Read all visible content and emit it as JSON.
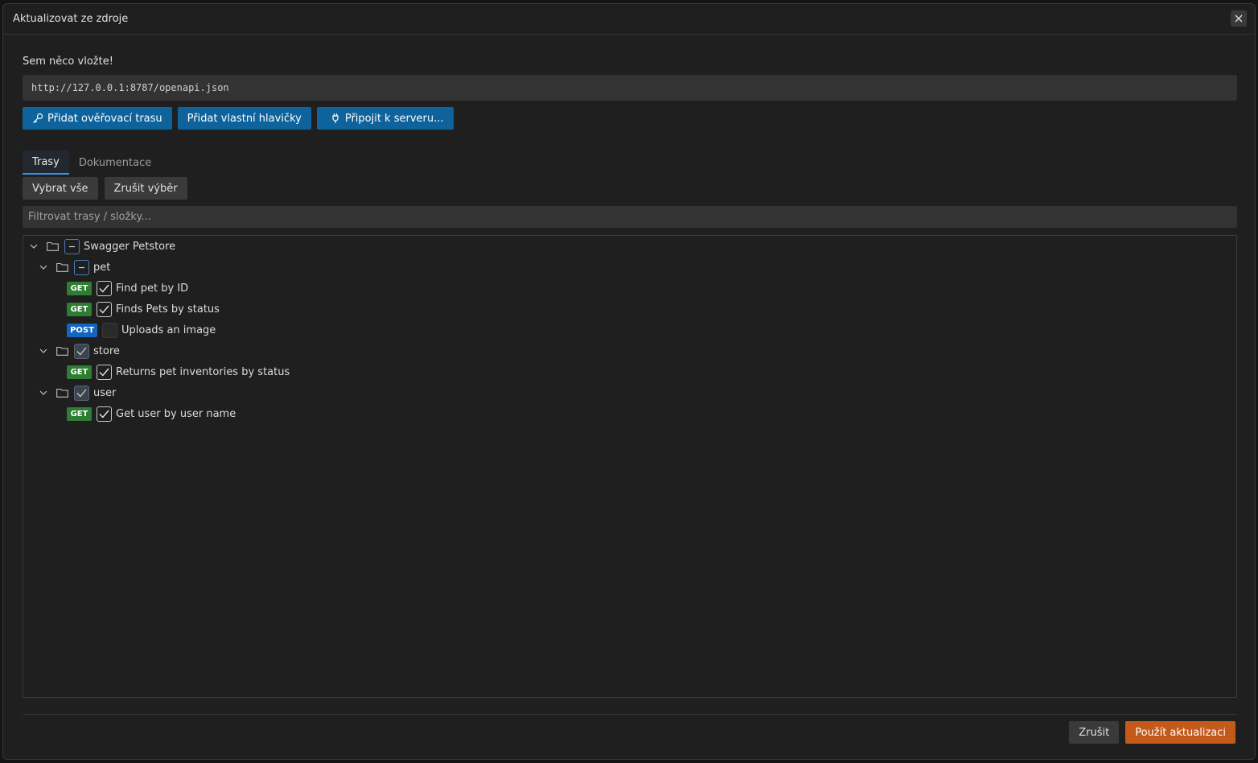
{
  "dialog": {
    "title": "Aktualizovat ze zdroje",
    "prompt": "Sem něco vložte!",
    "url_value": "http://127.0.0.1:8787/openapi.json"
  },
  "actions": {
    "add_auth_route": "Přidat ověřovací trasu",
    "add_custom_headers": "Přidat vlastní hlavičky",
    "connect_server": "Připojit k serveru..."
  },
  "tabs": [
    {
      "label": "Trasy",
      "active": true
    },
    {
      "label": "Dokumentace",
      "active": false
    }
  ],
  "selection": {
    "select_all": "Vybrat vše",
    "deselect": "Zrušit výběr"
  },
  "filter": {
    "placeholder": "Filtrovat trasy / složky..."
  },
  "tree": {
    "root": {
      "label": "Swagger Petstore",
      "state": "partial"
    },
    "folders": [
      {
        "label": "pet",
        "state": "partial",
        "routes": [
          {
            "method": "GET",
            "label": "Find pet by ID",
            "checked": true
          },
          {
            "method": "GET",
            "label": "Finds Pets by status",
            "checked": true
          },
          {
            "method": "POST",
            "label": "Uploads an image",
            "checked": false
          }
        ]
      },
      {
        "label": "store",
        "state": "checked",
        "routes": [
          {
            "method": "GET",
            "label": "Returns pet inventories by status",
            "checked": true
          }
        ]
      },
      {
        "label": "user",
        "state": "checked",
        "routes": [
          {
            "method": "GET",
            "label": "Get user by user name",
            "checked": true
          }
        ]
      }
    ]
  },
  "footer": {
    "cancel": "Zrušit",
    "apply": "Použít aktualizaci"
  },
  "colors": {
    "primary_blue": "#0e639c",
    "apply_orange": "#c45a1a",
    "get_green": "#2e7d32",
    "post_blue": "#1565c0"
  }
}
